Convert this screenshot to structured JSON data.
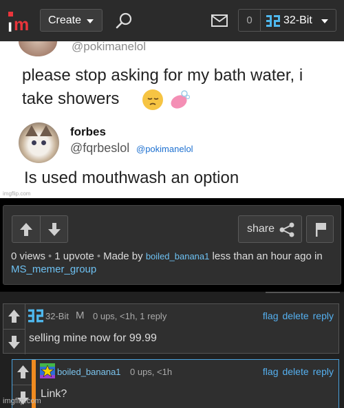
{
  "header": {
    "logo": "im",
    "create_label": "Create",
    "notification_count": "0",
    "username": "32-Bit"
  },
  "meme": {
    "top_handle": "@pokimanelol",
    "tweet_text": "please stop asking for my bath water, i take showers",
    "reply_name": "forbes",
    "reply_handle": "@fqrbeslol",
    "reply_mention": "@pokimanelol",
    "reply_text": "Is used mouthwash an option",
    "watermark": "imgflip.com"
  },
  "post_info": {
    "share_label": "share",
    "views": "0 views",
    "upvotes": "1 upvote",
    "made_by_prefix": "Made by",
    "author": "boiled_banana1",
    "time_text": "less than an hour ago in",
    "group": "MS_memer_group"
  },
  "comments": [
    {
      "user": "32-Bit",
      "badge": "M",
      "stats": "0 ups, <1h, 1 reply",
      "text": "selling mine now for 99.99",
      "actions": [
        "flag",
        "delete",
        "reply"
      ]
    },
    {
      "user": "boiled_banana1",
      "stats": "0 ups, <1h",
      "text": "Link?",
      "actions": [
        "flag",
        "delete",
        "reply"
      ]
    }
  ],
  "footer": {
    "watermark": "imgflip.com"
  },
  "colors": {
    "brand_red": "#e9353b",
    "link_blue": "#6ec1f2",
    "action_blue": "#55b0f0",
    "op_orange": "#f08b20"
  }
}
